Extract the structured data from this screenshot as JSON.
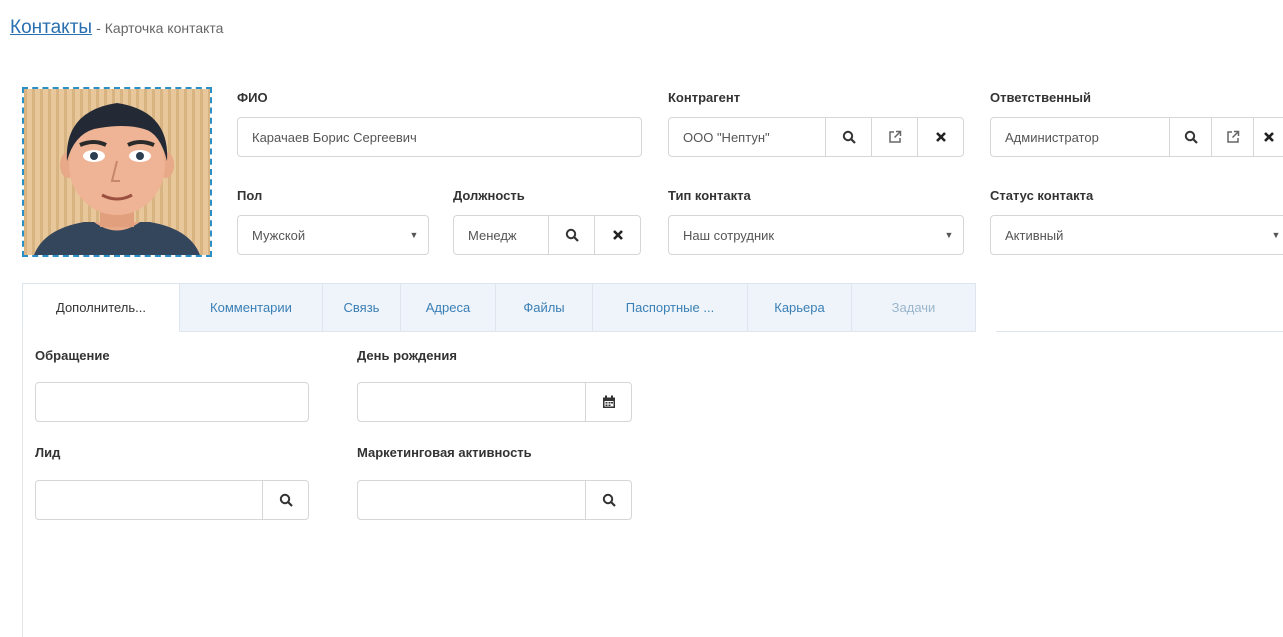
{
  "breadcrumb": {
    "link": "Контакты",
    "separator": "-",
    "current": "Карточка контакта"
  },
  "fields": {
    "fio": {
      "label": "ФИО",
      "value": "Карачаев Борис Сергеевич"
    },
    "counterparty": {
      "label": "Контрагент",
      "value": "ООО \"Нептун\""
    },
    "responsible": {
      "label": "Ответственный",
      "value": "Администратор"
    },
    "gender": {
      "label": "Пол",
      "value": "Мужской"
    },
    "position": {
      "label": "Должность",
      "value": "Менедж"
    },
    "contact_type": {
      "label": "Тип контакта",
      "value": "Наш сотрудник"
    },
    "contact_status": {
      "label": "Статус контакта",
      "value": "Активный"
    }
  },
  "tabs": [
    {
      "label": "Дополнитель...",
      "active": true
    },
    {
      "label": "Комментарии"
    },
    {
      "label": "Связь"
    },
    {
      "label": "Адреса"
    },
    {
      "label": "Файлы"
    },
    {
      "label": "Паспортные ..."
    },
    {
      "label": "Карьера"
    },
    {
      "label": "Задачи",
      "muted": true
    }
  ],
  "extra": {
    "salutation": {
      "label": "Обращение",
      "value": ""
    },
    "birthday": {
      "label": "День рождения",
      "value": ""
    },
    "lead": {
      "label": "Лид",
      "value": ""
    },
    "marketing": {
      "label": "Маркетинговая активность",
      "value": ""
    }
  },
  "icons": {
    "search": "search-icon",
    "open": "external-link-icon",
    "clear": "close-icon",
    "calendar": "calendar-icon",
    "dropdown": "caret-down-icon"
  },
  "colors": {
    "link": "#2a6fb0",
    "tab_text": "#3a7fb6",
    "tab_bg": "#eef4f9",
    "photo_border": "#2a8fc7"
  }
}
